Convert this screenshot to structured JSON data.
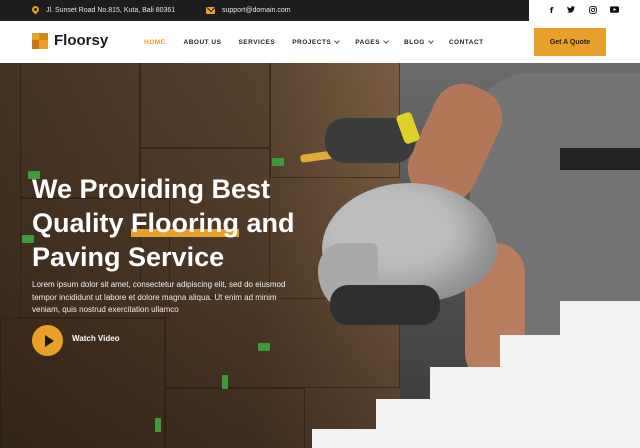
{
  "topbar": {
    "address": "Jl. Sunset Road No.815, Kuta, Bali 80361",
    "email": "support@domain.com",
    "social": [
      {
        "icon": "facebook-icon",
        "glyph": "f"
      },
      {
        "icon": "twitter-icon",
        "glyph": "🐦"
      },
      {
        "icon": "instagram-icon",
        "glyph": "◎"
      },
      {
        "icon": "youtube-icon",
        "glyph": "▶"
      }
    ]
  },
  "header": {
    "logo_text": "Floorsy",
    "nav": [
      {
        "label": "HOME",
        "active": true,
        "dropdown": false
      },
      {
        "label": "ABOUT US",
        "active": false,
        "dropdown": false
      },
      {
        "label": "SERVICES",
        "active": false,
        "dropdown": false
      },
      {
        "label": "PROJECTS",
        "active": false,
        "dropdown": true
      },
      {
        "label": "PAGES",
        "active": false,
        "dropdown": true
      },
      {
        "label": "BLOG",
        "active": false,
        "dropdown": true
      },
      {
        "label": "CONTACT",
        "active": false,
        "dropdown": false
      }
    ],
    "cta_label": "Get A Quote"
  },
  "hero": {
    "headline_line1": "We Providing Best",
    "headline_line2_a": "Quality ",
    "headline_line2_highlight": "Flooring",
    "headline_line2_b": " and",
    "headline_line3": "Paving Service",
    "paragraph": "Lorem ipsum dolor sit amet, consectetur adipiscing elit, sed do eiusmod tempor incididunt ut labore et dolore magna aliqua. Ut enim ad minim veniam, quis nostrud exercitation ullamco",
    "video_label": "Watch Video"
  },
  "colors": {
    "accent": "#e9a02b",
    "dark": "#1d1d1d"
  }
}
